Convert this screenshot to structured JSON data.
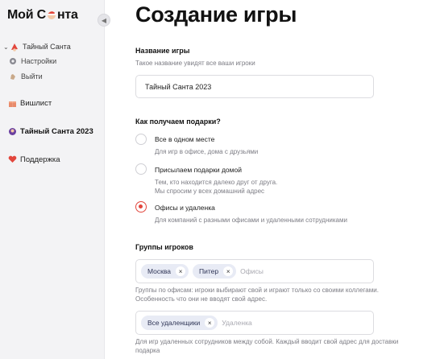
{
  "sidebar": {
    "logo_part1": "Мой С",
    "logo_part2": "нта",
    "collapse_icon": "chevron-left",
    "nav": {
      "group_label": "Тайный Санта",
      "settings_label": "Настройки",
      "logout_label": "Выйти",
      "wishlist_label": "Вишлист",
      "active_game_label": "Тайный Санта 2023",
      "support_label": "Поддержка"
    }
  },
  "main": {
    "title": "Создание игры",
    "game_name": {
      "label": "Название игры",
      "hint": "Такое название увидят все ваши игроки",
      "value": "Тайный Санта 2023"
    },
    "gifts": {
      "label": "Как получаем подарки?",
      "options": [
        {
          "label": "Все в одном месте",
          "hint": "Для игр в офисе, дома с друзьями",
          "checked": false
        },
        {
          "label": "Присылаем подарки домой",
          "hint_line1": "Тем, кто находится далеко друг от друга.",
          "hint_line2": "Мы спросим у всех домашний адрес",
          "checked": false
        },
        {
          "label": "Офисы и удаленка",
          "hint": "Для компаний с разными офисами и удаленными сотрудниками",
          "checked": true
        }
      ]
    },
    "groups": {
      "label": "Группы игроков",
      "offices": {
        "tags": [
          "Москва",
          "Питер"
        ],
        "placeholder": "Офисы",
        "hint_line1": "Группы по офисам: игроки выбирают свой и играют только со своими коллегами.",
        "hint_line2": "Особенность что они не вводят свой адрес."
      },
      "remote": {
        "tags": [
          "Все удаленщики"
        ],
        "placeholder": "Удаленка",
        "hint_line1": "Для игр удаленных сотрудников между собой. Каждый вводит свой адрес для доставки",
        "hint_line2": "подарка"
      }
    }
  },
  "colors": {
    "accent": "#e2463d",
    "tag_bg": "#e8ebf5",
    "sidebar_bg": "#f3f3f5"
  }
}
